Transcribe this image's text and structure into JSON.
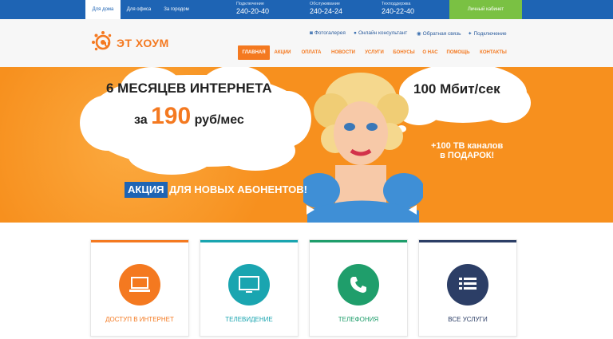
{
  "topbar": {
    "tabs": [
      "Для дома",
      "Для офиса",
      "За городом"
    ],
    "phones": [
      {
        "label": "Подключение",
        "number": "240-20-40"
      },
      {
        "label": "Обслуживание",
        "number": "240-24-24"
      },
      {
        "label": "Техподдержка",
        "number": "240-22-40"
      }
    ],
    "cabinet_label": "Личный кабинет"
  },
  "header": {
    "logo_text": "ЭТ ХОУМ",
    "util_links": [
      "Фотогалерея",
      "Онлайн консультант",
      "Обратная связь",
      "Подключение"
    ],
    "nav": [
      "ГЛАВНАЯ",
      "АКЦИИ",
      "ОПЛАТА",
      "НОВОСТИ",
      "УСЛУГИ",
      "БОНУСЫ",
      "О НАС",
      "ПОМОЩЬ",
      "КОНТАКТЫ"
    ]
  },
  "banner": {
    "headline": "6 МЕСЯЦЕВ ИНТЕРНЕТА",
    "price_prefix": "за",
    "price": "190",
    "price_suffix": "руб/мес",
    "speed": "100 Мбит/сек",
    "tv_line1": "+100 ТВ каналов",
    "tv_line2": "в ПОДАРОК!",
    "badge": "АКЦИЯ",
    "badge_rest": "ДЛЯ НОВЫХ АБОНЕНТОВ!",
    "active_slide": 2,
    "slide_count": 4
  },
  "services": [
    {
      "label": "ДОСТУП В ИНТЕРНЕТ",
      "color": "#f47920",
      "icon": "laptop-icon"
    },
    {
      "label": "ТЕЛЕВИДЕНИЕ",
      "color": "#1aa5b0",
      "icon": "tv-icon"
    },
    {
      "label": "ТЕЛЕФОНИЯ",
      "color": "#1f9e6b",
      "icon": "phone-icon"
    },
    {
      "label": "ВСЕ УСЛУГИ",
      "color": "#2c3e66",
      "icon": "list-icon"
    }
  ]
}
